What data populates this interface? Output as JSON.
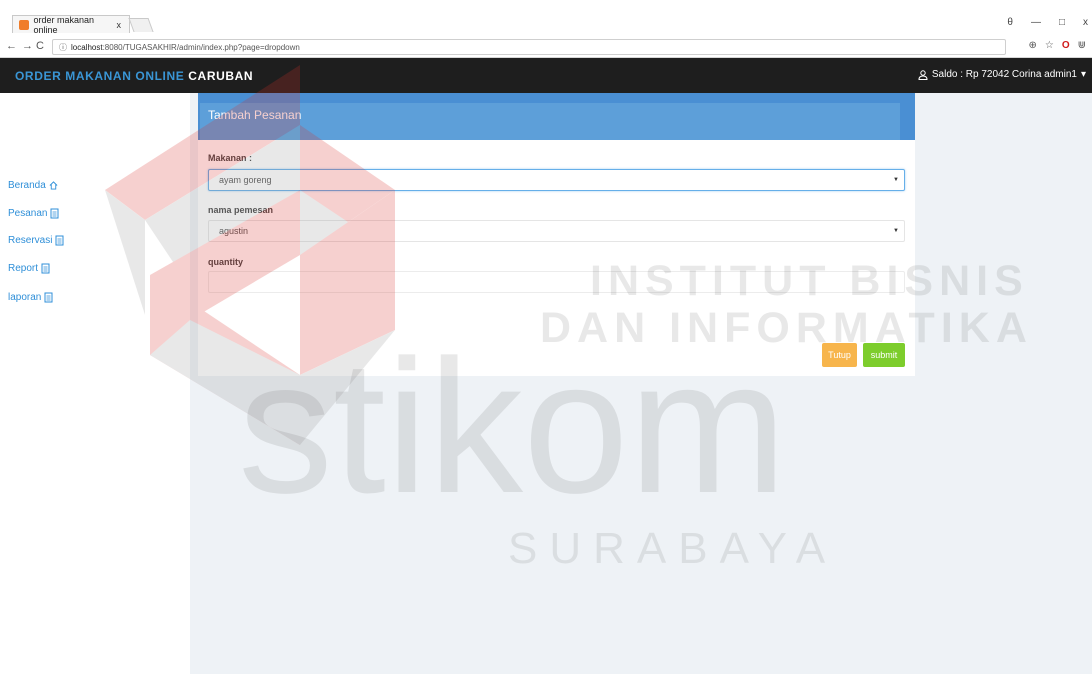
{
  "browser": {
    "tab_title": "order makanan online",
    "tab_close": "x",
    "url_prefix": "localhost",
    "url_rest": ":8080/TUGASAKHIR/admin/index.php?page=dropdown",
    "window_controls": [
      "θ",
      "—",
      "□",
      "x"
    ],
    "toolbar_icons": [
      "⊕",
      "☆",
      "O",
      "⋓"
    ]
  },
  "navbar": {
    "brand_part1": "ORDER MAKANAN ONLINE",
    "brand_part2": "CARUBAN",
    "user_text": "Saldo : Rp 72042 Corina admin1",
    "caret": "▾"
  },
  "sidebar": {
    "items": [
      {
        "label": "Beranda",
        "icon": "home-icon"
      },
      {
        "label": "Pesanan",
        "icon": "clipboard-icon"
      },
      {
        "label": "Reservasi",
        "icon": "clipboard-icon"
      },
      {
        "label": "Report",
        "icon": "clipboard-icon"
      },
      {
        "label": "laporan",
        "icon": "clipboard-icon"
      }
    ]
  },
  "modal": {
    "title": "Tambah Pesanan",
    "makanan_label": "Makanan :",
    "makanan_value": "ayam goreng",
    "nama_label": "nama pemesan",
    "nama_value": "agustin",
    "quantity_label": "quantity",
    "quantity_value": "",
    "tutup_label": "Tutup",
    "submit_label": "submit"
  },
  "watermark": {
    "line1": "INSTITUT BISNIS",
    "line2": "DAN INFORMATIKA",
    "word": "stikom",
    "city": "SURABAYA"
  },
  "colors": {
    "accent_blue": "#2f8fd8",
    "header_blue": "#4a8fd3",
    "navbar_bg": "#1e1e1e",
    "btn_warning": "#f7b54c",
    "btn_success": "#7dcd2c",
    "watermark_red": "#d9302a"
  }
}
